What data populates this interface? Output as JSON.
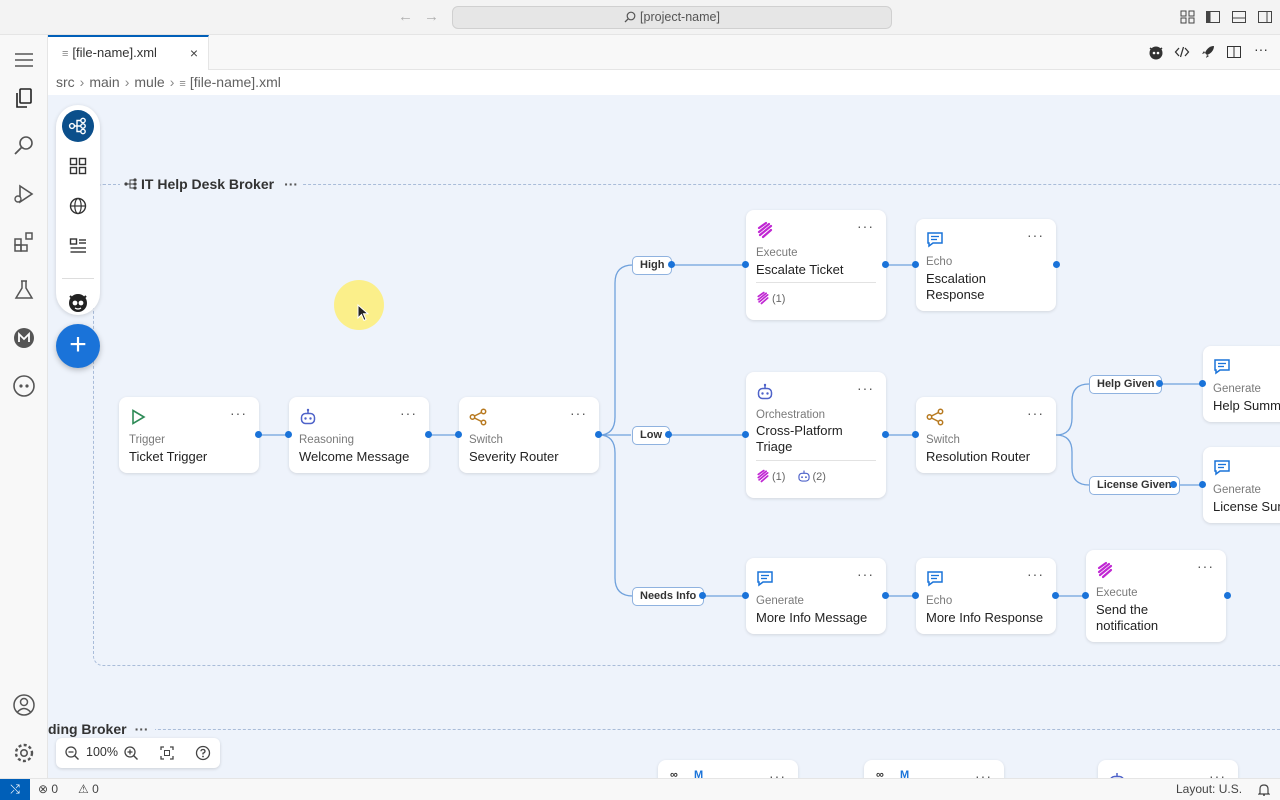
{
  "titlebar": {
    "search_text": "[project-name]"
  },
  "tab": {
    "label": "[file-name].xml",
    "close": "×"
  },
  "breadcrumb": {
    "items": [
      "src",
      "main",
      "mule",
      "[file-name].xml"
    ]
  },
  "group": {
    "title": "IT Help Desk Broker",
    "dots": "···"
  },
  "group2": {
    "title": "ding Broker",
    "dots": "···"
  },
  "add_button": "+",
  "nodes": {
    "trigger": {
      "type": "Trigger",
      "name": "Ticket Trigger"
    },
    "reasoning": {
      "type": "Reasoning",
      "name": "Welcome Message"
    },
    "switch1": {
      "type": "Switch",
      "name": "Severity Router"
    },
    "execute1": {
      "type": "Execute",
      "name": "Escalate Ticket",
      "footer": "(1)"
    },
    "echo1": {
      "type": "Echo",
      "name_line1": "Escalation",
      "name_line2": "Response"
    },
    "orchestration": {
      "type": "Orchestration",
      "name_line1": "Cross-Platform",
      "name_line2": "Triage",
      "footer_a": "(1)",
      "footer_b": "(2)"
    },
    "switch2": {
      "type": "Switch",
      "name": "Resolution Router"
    },
    "generate1": {
      "type": "Generate",
      "name": "Help Summa"
    },
    "generate2": {
      "type": "Generate",
      "name": "License Sum"
    },
    "generate3": {
      "type": "Generate",
      "name": "More Info Message"
    },
    "echo2": {
      "type": "Echo",
      "name": "More Info Response"
    },
    "execute2": {
      "type": "Execute",
      "name_line1": "Send the",
      "name_line2": "notification"
    }
  },
  "branches": {
    "high": "High",
    "low": "Low",
    "needs_info": "Needs Info",
    "help_given": "Help Given",
    "license_given": "License Given"
  },
  "node_menu": "···",
  "zoom": {
    "value": "100%"
  },
  "status": {
    "errors": "0",
    "warnings": "0",
    "layout": "Layout: U.S."
  },
  "colors": {
    "accent": "#1a73d9",
    "selected": "#0b4f8b",
    "execute": "#c026d3",
    "agent": "#4f63c9",
    "switch": "#b7791f",
    "echo": "#1a73d9",
    "trigger": "#2e8b57"
  }
}
